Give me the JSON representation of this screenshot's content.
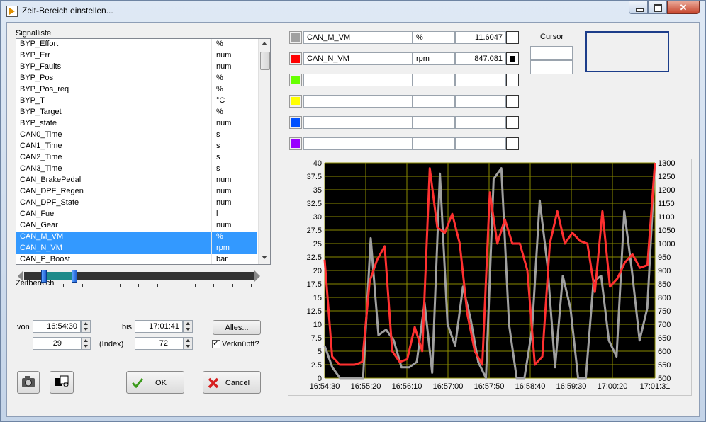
{
  "window": {
    "title": "Zeit-Bereich einstellen...",
    "close_label": "✕"
  },
  "signal_list": {
    "label": "Signalliste",
    "rows": [
      {
        "name": "BYP_Effort",
        "unit": "%"
      },
      {
        "name": "BYP_Err",
        "unit": "num"
      },
      {
        "name": "BYP_Faults",
        "unit": "num"
      },
      {
        "name": "BYP_Pos",
        "unit": "%"
      },
      {
        "name": "BYP_Pos_req",
        "unit": "%"
      },
      {
        "name": "BYP_T",
        "unit": "°C"
      },
      {
        "name": "BYP_Target",
        "unit": "%"
      },
      {
        "name": "BYP_state",
        "unit": "num"
      },
      {
        "name": "CAN0_Time",
        "unit": "s"
      },
      {
        "name": "CAN1_Time",
        "unit": "s"
      },
      {
        "name": "CAN2_Time",
        "unit": "s"
      },
      {
        "name": "CAN3_Time",
        "unit": "s"
      },
      {
        "name": "CAN_BrakePedal",
        "unit": "num"
      },
      {
        "name": "CAN_DPF_Regen",
        "unit": "num"
      },
      {
        "name": "CAN_DPF_State",
        "unit": "num"
      },
      {
        "name": "CAN_Fuel",
        "unit": "l"
      },
      {
        "name": "CAN_Gear",
        "unit": "num"
      },
      {
        "name": "CAN_M_VM",
        "unit": "%",
        "selected": true
      },
      {
        "name": "CAN_N_VM",
        "unit": "rpm",
        "selected": true
      },
      {
        "name": "CAN_P_Boost",
        "unit": "bar"
      }
    ]
  },
  "zeitbereich": {
    "label": "Zeitbereich",
    "von_label": "von",
    "bis_label": "bis",
    "von_time": "16:54:30",
    "bis_time": "17:01:41",
    "von_index": "29",
    "bis_index": "72",
    "index_label": "(Index)",
    "alles_label": "Alles...",
    "verknuepft_label": "Verknüpft?",
    "verknuepft_checked": true
  },
  "buttons": {
    "ok_label": "OK",
    "cancel_label": "Cancel",
    "ok_icon": "check-icon",
    "cancel_icon": "x-icon",
    "camera_icon": "camera-icon",
    "plot_settings_icon": "plot-settings-icon"
  },
  "channels": [
    {
      "color": "#a0a0a0",
      "name": "CAN_M_VM",
      "unit": "%",
      "value": "11.6047",
      "checkbox_filled": false
    },
    {
      "color": "#ff0000",
      "name": "CAN_N_VM",
      "unit": "rpm",
      "value": "847.081",
      "checkbox_filled": true
    },
    {
      "color": "#66ff00",
      "name": "",
      "unit": "",
      "value": "",
      "checkbox_filled": false
    },
    {
      "color": "#ffff00",
      "name": "",
      "unit": "",
      "value": "",
      "checkbox_filled": false
    },
    {
      "color": "#0050ff",
      "name": "",
      "unit": "",
      "value": "",
      "checkbox_filled": false
    },
    {
      "color": "#9900ff",
      "name": "",
      "unit": "",
      "value": "",
      "checkbox_filled": false
    }
  ],
  "cursor": {
    "label": "Cursor",
    "value1": "",
    "value2": ""
  },
  "chart_data": {
    "type": "line",
    "x_tick_labels": [
      "16:54:30",
      "16:55:20",
      "16:56:10",
      "16:57:00",
      "16:57:50",
      "16:58:40",
      "16:59:30",
      "17:00:20",
      "17:01:31"
    ],
    "y_left_ticks": [
      "0",
      "2.5",
      "5",
      "7.5",
      "10",
      "12.5",
      "15",
      "17.5",
      "20",
      "22.5",
      "25",
      "27.5",
      "30",
      "32.5",
      "35",
      "37.5",
      "40"
    ],
    "y_right_ticks": [
      "500",
      "550",
      "600",
      "650",
      "700",
      "750",
      "800",
      "850",
      "900",
      "950",
      "1000",
      "1050",
      "1100",
      "1150",
      "1200",
      "1250",
      "1300"
    ],
    "ylim_left": [
      0,
      40
    ],
    "ylim_right": [
      500,
      1300
    ],
    "grid": true,
    "background": "#000000",
    "grid_color": "#8a8a00",
    "series": [
      {
        "name": "CAN_M_VM",
        "axis": "left",
        "color": "#a0a0a0",
        "values": [
          6,
          2,
          0,
          0,
          0,
          0,
          26,
          8,
          9,
          7,
          2,
          2,
          3,
          14,
          1,
          38,
          10,
          6,
          17,
          11,
          3,
          0,
          37,
          39,
          10,
          0,
          0,
          9,
          33,
          21,
          2,
          19,
          13,
          0,
          0,
          18,
          19,
          7,
          4,
          31,
          20,
          7,
          13,
          40
        ]
      },
      {
        "name": "CAN_N_VM",
        "axis": "right",
        "color": "#ff3030",
        "values": [
          940,
          580,
          550,
          550,
          550,
          560,
          860,
          940,
          990,
          600,
          560,
          570,
          690,
          600,
          1280,
          1060,
          1040,
          1110,
          1000,
          740,
          600,
          550,
          1190,
          1000,
          1090,
          1000,
          1000,
          900,
          550,
          580,
          1000,
          1120,
          1000,
          1040,
          1010,
          1000,
          820,
          1120,
          840,
          870,
          930,
          960,
          910,
          920,
          1300
        ]
      }
    ]
  }
}
